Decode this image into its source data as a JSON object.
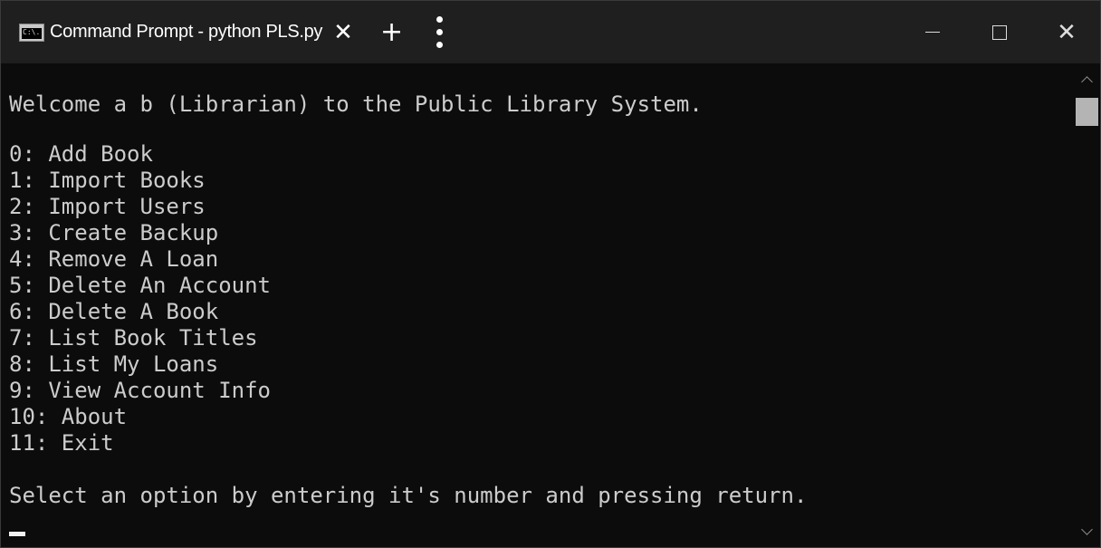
{
  "window": {
    "tab_title": "Command Prompt - python  PLS.py",
    "tab_icon": "command-prompt-icon",
    "close_tab_glyph": "✕",
    "new_tab_glyph": "+",
    "controls": {
      "minimize": "minimize-icon",
      "maximize": "maximize-icon",
      "close": "close-icon"
    }
  },
  "terminal": {
    "welcome": "Welcome a b (Librarian) to the Public Library System.",
    "menu_options": [
      "0: Add Book",
      "1: Import Books",
      "2: Import Users",
      "3: Create Backup",
      "4: Remove A Loan",
      "5: Delete An Account",
      "6: Delete A Book",
      "7: List Book Titles",
      "8: List My Loans",
      "9: View Account Info",
      "10: About",
      "11: Exit"
    ],
    "prompt": "Select an option by entering it's number and pressing return."
  },
  "colors": {
    "background": "#0c0c0c",
    "titlebar": "#1f1f1f",
    "text": "#cccccc"
  }
}
